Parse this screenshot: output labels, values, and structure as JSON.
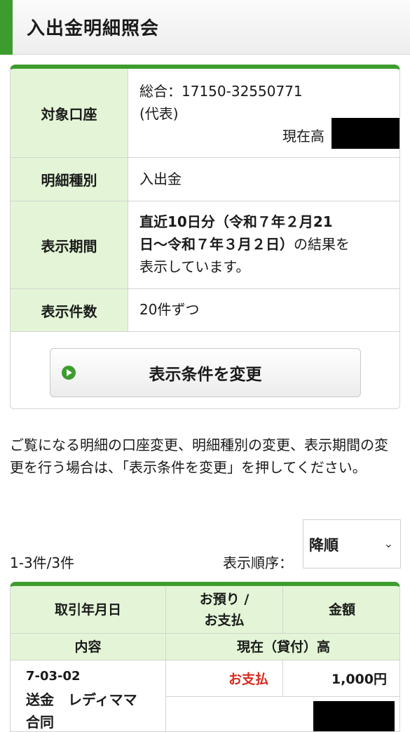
{
  "header": {
    "title": "入出金明細照会"
  },
  "info": {
    "account_label": "対象口座",
    "account_line1": "総合：17150-32550771",
    "account_line2": "(代表)",
    "balance_label": "現在高",
    "type_label": "明細種別",
    "type_value": "入出金",
    "period_label": "表示期間",
    "period_line1": "直近10日分（令和７年２月21",
    "period_line2_bold": "日～令和７年３月２日）",
    "period_line2_rest": "の結果を",
    "period_line3": "表示しています。",
    "count_label": "表示件数",
    "count_value": "20件ずつ",
    "change_button": "表示条件を変更"
  },
  "notice": "ご覧になる明細の口座変更、明細種別の変更、表示期間の変更を行う場合は、「表示条件を変更」を押してください。",
  "list": {
    "range": "1-3件/3件",
    "sort_label": "表示順序：",
    "sort_value": "降順"
  },
  "table": {
    "headers": {
      "date": "取引年月日",
      "deposit_withdraw_1": "お預り /",
      "deposit_withdraw_2": "お支払",
      "amount": "金額",
      "content": "内容",
      "balance": "現在（貸付）高"
    },
    "rows": [
      {
        "date": "7-03-02",
        "content_1": "送金　レディママ",
        "content_2": "合同",
        "type": "お支払",
        "amount": "1,000円"
      }
    ]
  },
  "colors": {
    "accent": "#3d9c2e",
    "header_cell": "#e3f5d6",
    "withdraw": "#d62b1f"
  }
}
